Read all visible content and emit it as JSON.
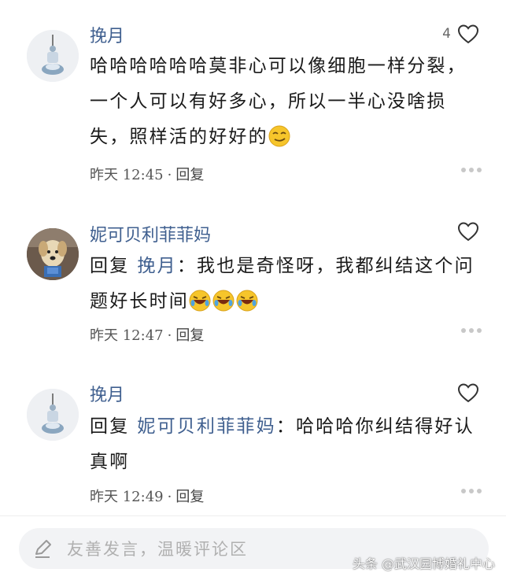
{
  "comments": [
    {
      "username": "挽月",
      "like_count": "4",
      "content": "哈哈哈哈哈哈莫非心可以像细胞一样分裂，一个人可以有好多心，所以一半心没啥损失，照样活的好好的",
      "emoji": [
        "smirk-emoji"
      ],
      "time": "昨天 12:45",
      "reply_label": "回复"
    },
    {
      "username": "妮可贝利菲菲妈",
      "like_count": "",
      "reply_prefix": "回复",
      "mention": "挽月",
      "content": "：我也是奇怪呀，我都纠结这个问题好长时间",
      "emoji": [
        "rofl-emoji",
        "rofl-emoji",
        "rofl-emoji"
      ],
      "time": "昨天 12:47",
      "reply_label": "回复"
    },
    {
      "username": "挽月",
      "like_count": "",
      "reply_prefix": "回复",
      "mention": "妮可贝利菲菲妈",
      "content": "：哈哈哈你纠结得好认真啊",
      "emoji": [],
      "time": "昨天 12:49",
      "reply_label": "回复"
    }
  ],
  "meta_separator": "·",
  "input": {
    "placeholder": "友善发言，温暖评论区"
  },
  "watermark": "头条 @武汉园博婚礼中心",
  "icons": {
    "like": "heart-outline-icon",
    "more": "more-dots-icon",
    "compose": "pen-icon"
  },
  "colors": {
    "username": "#3f5f8f",
    "meta": "#555555",
    "input_bg": "#f2f3f5",
    "placeholder": "#b0b0b0"
  }
}
